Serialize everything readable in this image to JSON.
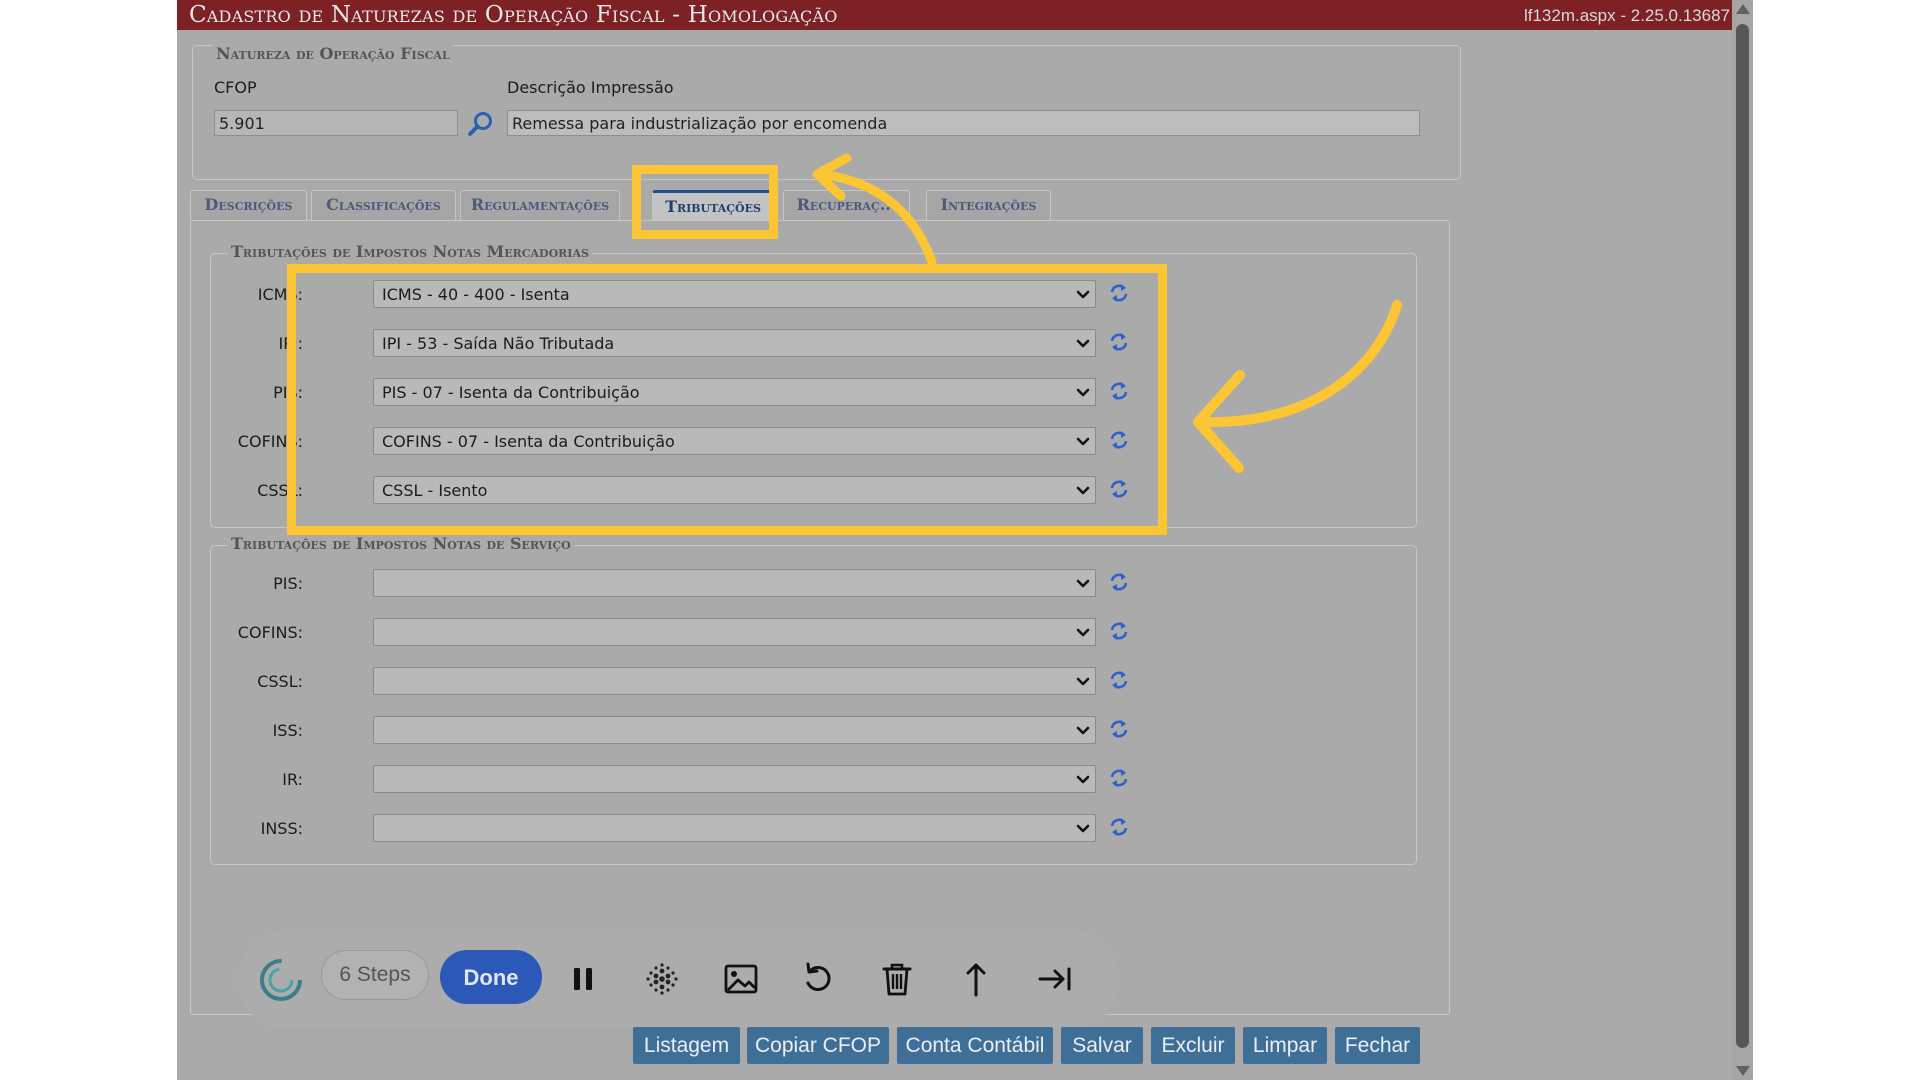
{
  "window": {
    "title": "Cadastro de Naturezas de Operação Fiscal  - Homologação",
    "version": "lf132m.aspx - 2.25.0.13687"
  },
  "natureza": {
    "legend": "Natureza de Operação Fiscal",
    "cfop_label": "CFOP",
    "cfop_value": "5.901",
    "descricao_label": "Descrição Impressão",
    "descricao_value": "Remessa para industrialização por encomenda"
  },
  "tabs": [
    {
      "label": "Descrições"
    },
    {
      "label": "Classificações"
    },
    {
      "label": "Regulamentações"
    },
    {
      "label": "Tributações",
      "active": true
    },
    {
      "label": "Recuperaç..."
    },
    {
      "label": "Integrações"
    }
  ],
  "mercadorias": {
    "legend": "Tributações de Impostos Notas Mercadorias",
    "rows": [
      {
        "label": "ICMS:",
        "value": "ICMS - 40 - 400 - Isenta"
      },
      {
        "label": "IPI:",
        "value": "IPI - 53 - Saída Não Tributada"
      },
      {
        "label": "PIS:",
        "value": "PIS - 07 - Isenta da Contribuição"
      },
      {
        "label": "COFINS:",
        "value": "COFINS - 07 - Isenta da Contribuição"
      },
      {
        "label": "CSSL:",
        "value": "CSSL - Isento"
      }
    ]
  },
  "servico": {
    "legend": "Tributações de Impostos Notas de Serviço",
    "rows": [
      {
        "label": "PIS:",
        "value": ""
      },
      {
        "label": "COFINS:",
        "value": ""
      },
      {
        "label": "CSSL:",
        "value": ""
      },
      {
        "label": "ISS:",
        "value": ""
      },
      {
        "label": "IR:",
        "value": ""
      },
      {
        "label": "INSS:",
        "value": ""
      }
    ]
  },
  "recorder": {
    "steps_label": "6 Steps",
    "done_label": "Done"
  },
  "buttons": {
    "listagem": "Listagem",
    "copiar_cfop": "Copiar CFOP",
    "conta_contabil": "Conta Contábil",
    "salvar": "Salvar",
    "excluir": "Excluir",
    "limpar": "Limpar",
    "fechar": "Fechar"
  },
  "colors": {
    "titlebar": "#7d2125",
    "highlight": "#fcc534",
    "button": "#3f6f97",
    "done": "#2c59b8",
    "refresh_icon": "#2f62c9"
  },
  "icons": [
    "search-icon",
    "chevron-down-icon",
    "refresh-icon",
    "pause-icon",
    "blur-icon",
    "image-icon",
    "undo-icon",
    "trash-icon",
    "arrow-up-icon",
    "skip-to-end-icon",
    "logo-icon",
    "curved-arrow-icon"
  ]
}
